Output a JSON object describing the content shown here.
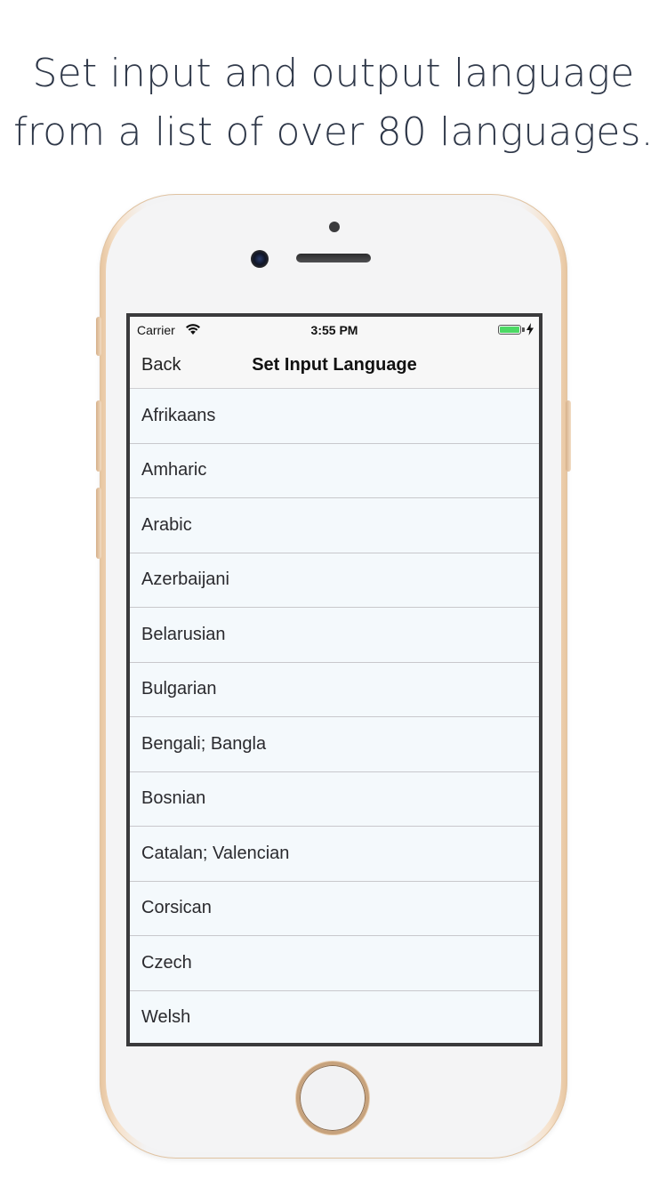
{
  "headline": {
    "line1": "Set input and output language",
    "line2": "from a list of over 80 languages."
  },
  "status_bar": {
    "carrier": "Carrier",
    "time": "3:55 PM",
    "icons": [
      "wifi-icon",
      "battery-icon",
      "charging-bolt-icon"
    ],
    "battery_color": "#4cd964"
  },
  "nav": {
    "back_label": "Back",
    "title": "Set Input Language"
  },
  "languages": [
    "Afrikaans",
    "Amharic",
    "Arabic",
    "Azerbaijani",
    "Belarusian",
    "Bulgarian",
    "Bengali; Bangla",
    "Bosnian",
    "Catalan; Valencian",
    "Corsican",
    "Czech",
    "Welsh"
  ]
}
